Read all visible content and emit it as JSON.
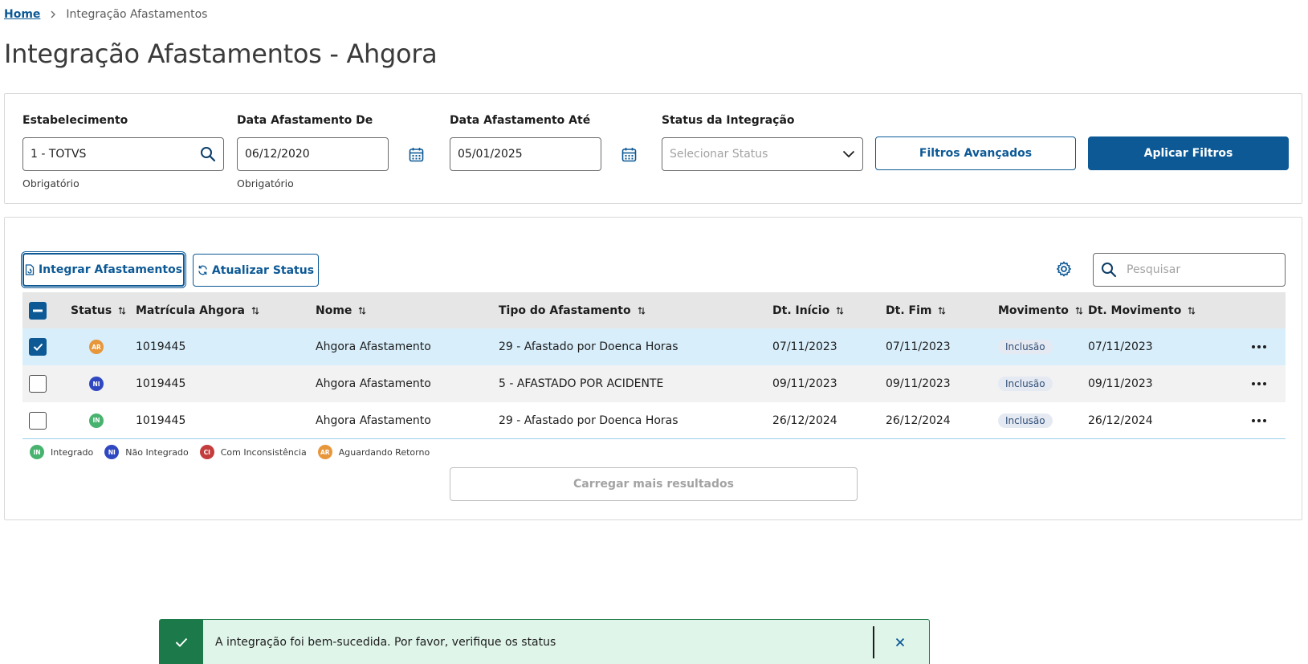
{
  "breadcrumb": {
    "home": "Home",
    "current": "Integração Afastamentos"
  },
  "page": {
    "title": "Integração Afastamentos - Ahgora"
  },
  "filters": {
    "establishment": {
      "label": "Estabelecimento",
      "value": "1 - TOTVS",
      "help": "Obrigatório"
    },
    "date_from": {
      "label": "Data Afastamento De",
      "value": "06/12/2020",
      "help": "Obrigatório"
    },
    "date_to": {
      "label": "Data Afastamento Até",
      "value": "05/01/2025"
    },
    "status": {
      "label": "Status da Integração",
      "placeholder": "Selecionar Status"
    },
    "advanced_button": "Filtros Avançados",
    "apply_button": "Aplicar Filtros"
  },
  "actions": {
    "integrate_button": "Integrar Afastamentos",
    "refresh_button": "Atualizar Status",
    "search_placeholder": "Pesquisar"
  },
  "table": {
    "headers": {
      "status": "Status",
      "matricula": "Matrícula Ahgora",
      "nome": "Nome",
      "tipo": "Tipo do Afastamento",
      "inicio": "Dt. Início",
      "fim": "Dt. Fim",
      "movimento": "Movimento",
      "dt_movimento": "Dt. Movimento"
    },
    "rows": [
      {
        "selected": true,
        "status": "AR",
        "matricula": "1019445",
        "nome": "Ahgora Afastamento",
        "tipo": "29 - Afastado por Doenca Horas",
        "inicio": "07/11/2023",
        "fim": "07/11/2023",
        "movimento": "Inclusão",
        "dt_movimento": "07/11/2023"
      },
      {
        "selected": false,
        "status": "NI",
        "matricula": "1019445",
        "nome": "Ahgora Afastamento",
        "tipo": "5 - AFASTADO POR ACIDENTE",
        "inicio": "09/11/2023",
        "fim": "09/11/2023",
        "movimento": "Inclusão",
        "dt_movimento": "09/11/2023"
      },
      {
        "selected": false,
        "status": "IN",
        "matricula": "1019445",
        "nome": "Ahgora Afastamento",
        "tipo": "29 - Afastado por Doenca Horas",
        "inicio": "26/12/2024",
        "fim": "26/12/2024",
        "movimento": "Inclusão",
        "dt_movimento": "26/12/2024"
      }
    ]
  },
  "legend": [
    {
      "code": "IN",
      "label": "Integrado"
    },
    {
      "code": "NI",
      "label": "Não Integrado"
    },
    {
      "code": "CI",
      "label": "Com Inconsistência"
    },
    {
      "code": "AR",
      "label": "Aguardando Retorno"
    }
  ],
  "load_more": "Carregar mais resultados",
  "toast": {
    "message": "A integração foi bem-sucedida. Por favor, verifique os status"
  },
  "colors": {
    "primary": "#0c5996",
    "success": "#1c7a4a",
    "status_IN": "#47b36e",
    "status_NI": "#2f48c1",
    "status_CI": "#c43c3c",
    "status_AR": "#e8963a"
  }
}
